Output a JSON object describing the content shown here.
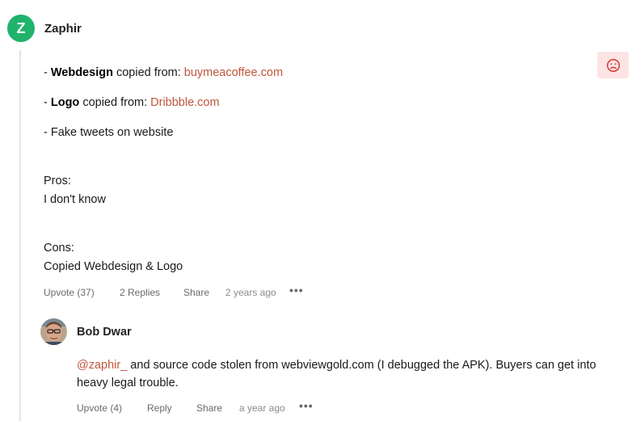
{
  "comment": {
    "author": "Zaphir",
    "avatar_letter": "Z",
    "avatar_color": "#1fb36b",
    "sentiment_icon": "sad-face-icon",
    "lines": {
      "l1_prefix": "- ",
      "l1_bold": "Webdesign",
      "l1_text": " copied from: ",
      "l1_link": "buymeacoffee.com",
      "l2_prefix": "- ",
      "l2_bold": "Logo",
      "l2_text": " copied from: ",
      "l2_link": "Dribbble.com",
      "l3": "- Fake tweets on website",
      "pros_heading": "Pros:",
      "pros_text": "I don't know",
      "cons_heading": "Cons:",
      "cons_text": "Copied Webdesign & Logo"
    },
    "actions": {
      "upvote": "Upvote (37)",
      "replies": "2 Replies",
      "share": "Share",
      "timestamp": "2 years ago",
      "more": "•••"
    }
  },
  "reply": {
    "author": "Bob Dwar",
    "mention": "@zaphir_",
    "text": " and source code stolen from webviewgold.com (I debugged the APK). Buyers can get into heavy legal trouble.",
    "actions": {
      "upvote": "Upvote (4)",
      "reply": "Reply",
      "share": "Share",
      "timestamp": "a year ago",
      "more": "•••"
    }
  },
  "colors": {
    "link": "#c0553b",
    "sentiment_bg": "#fde4e4",
    "sentiment_icon": "#d6423b"
  }
}
